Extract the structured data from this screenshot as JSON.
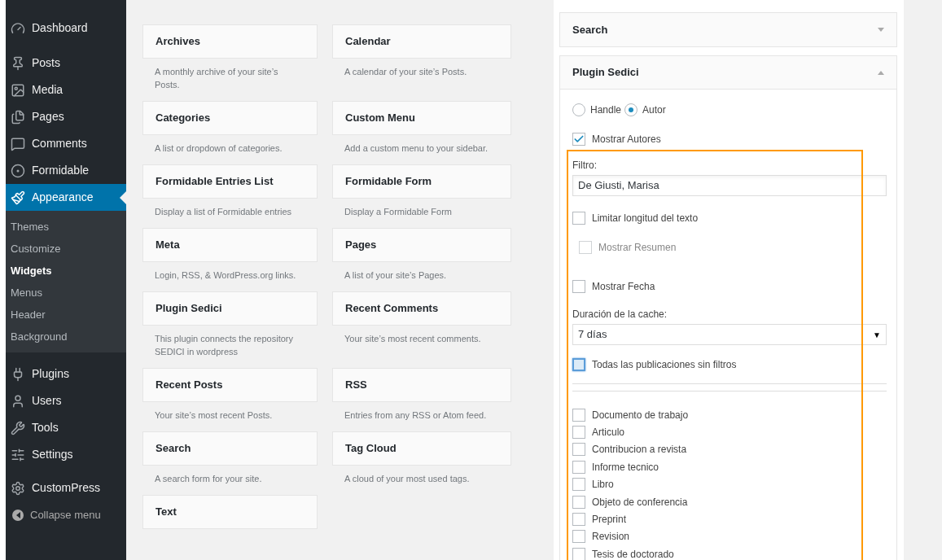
{
  "sidebar": {
    "items": [
      {
        "label": "Dashboard",
        "selected": false
      },
      {
        "label": "Posts",
        "selected": false
      },
      {
        "label": "Media",
        "selected": false
      },
      {
        "label": "Pages",
        "selected": false
      },
      {
        "label": "Comments",
        "selected": false
      },
      {
        "label": "Formidable",
        "selected": false
      },
      {
        "label": "Appearance",
        "selected": true,
        "children": [
          {
            "label": "Themes",
            "selected": false
          },
          {
            "label": "Customize",
            "selected": false
          },
          {
            "label": "Widgets",
            "selected": true
          },
          {
            "label": "Menus",
            "selected": false
          },
          {
            "label": "Header",
            "selected": false
          },
          {
            "label": "Background",
            "selected": false
          }
        ]
      },
      {
        "label": "Plugins",
        "selected": false
      },
      {
        "label": "Users",
        "selected": false
      },
      {
        "label": "Tools",
        "selected": false
      },
      {
        "label": "Settings",
        "selected": false
      },
      {
        "label": "CustomPress",
        "selected": false
      }
    ],
    "collapse": "Collapse menu"
  },
  "available_widgets": [
    {
      "title": "Archives",
      "description": "A monthly archive of your site’s Posts."
    },
    {
      "title": "Calendar",
      "description": "A calendar of your site’s Posts."
    },
    {
      "title": "Categories",
      "description": "A list or dropdown of categories."
    },
    {
      "title": "Custom Menu",
      "description": "Add a custom menu to your sidebar."
    },
    {
      "title": "Formidable Entries List",
      "description": "Display a list of Formidable entries"
    },
    {
      "title": "Formidable Form",
      "description": "Display a Formidable Form"
    },
    {
      "title": "Meta",
      "description": "Login, RSS, & WordPress.org links."
    },
    {
      "title": "Pages",
      "description": "A list of your site’s Pages."
    },
    {
      "title": "Plugin Sedici",
      "description": "This plugin connects the repository SEDICI in wordpress"
    },
    {
      "title": "Recent Comments",
      "description": "Your site’s most recent comments."
    },
    {
      "title": "Recent Posts",
      "description": "Your site’s most recent Posts."
    },
    {
      "title": "RSS",
      "description": "Entries from any RSS or Atom feed."
    },
    {
      "title": "Search",
      "description": "A search form for your site."
    },
    {
      "title": "Tag Cloud",
      "description": "A cloud of your most used tags."
    },
    {
      "title": "Text"
    }
  ],
  "sidebar_widgets": [
    {
      "title": "Search",
      "expanded": false
    },
    {
      "title": "Plugin Sedici",
      "expanded": true
    }
  ],
  "plugin_form": {
    "mode": [
      {
        "label": "Handle",
        "selected": false
      },
      {
        "label": "Autor",
        "selected": true
      }
    ],
    "mostrar_autores": {
      "label": "Mostrar Autores",
      "checked": true
    },
    "filtro": {
      "label": "Filtro:",
      "value": "De Giusti, Marisa"
    },
    "options": [
      {
        "label": "Limitar longitud del texto",
        "checked": false,
        "disabled": false
      },
      {
        "label": "Mostrar Resumen",
        "checked": false,
        "disabled": true
      },
      {
        "label": "Mostrar Fecha",
        "checked": false,
        "disabled": false
      }
    ],
    "cache": {
      "label": "Duración de la cache:",
      "value": "7 días",
      "arrow": "▼"
    },
    "todas": {
      "label": "Todas las publicaciones sin filtros",
      "checked": false,
      "focused": true
    },
    "types": [
      {
        "label": "Documento de trabajo",
        "checked": false
      },
      {
        "label": "Articulo",
        "checked": false
      },
      {
        "label": "Contribucion a revista",
        "checked": false
      },
      {
        "label": "Informe tecnico",
        "checked": false
      },
      {
        "label": "Libro",
        "checked": false
      },
      {
        "label": "Objeto de conferencia",
        "checked": false
      },
      {
        "label": "Preprint",
        "checked": false
      },
      {
        "label": "Revision",
        "checked": false
      },
      {
        "label": "Tesis de doctorado",
        "checked": false
      }
    ]
  }
}
